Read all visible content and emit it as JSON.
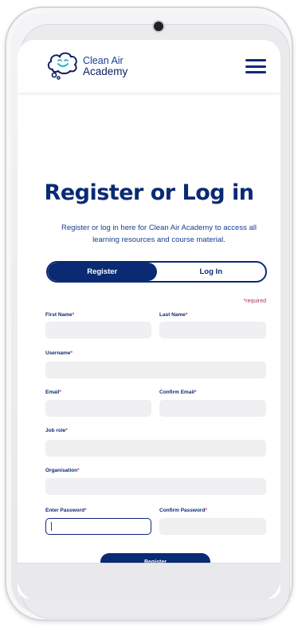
{
  "header": {
    "logo_line1": "Clean Air",
    "logo_line2": "Academy"
  },
  "page": {
    "title": "Register or Log in",
    "subtitle": "Register or log in here for Clean Air Academy to access all learning resources and course material.",
    "tabs": [
      {
        "label": "Register",
        "active": true
      },
      {
        "label": "Log In",
        "active": false
      }
    ],
    "required_note": "*required"
  },
  "form": {
    "first_name_label": "First Name",
    "last_name_label": "Last Name",
    "username_label": "Username",
    "email_label": "Email",
    "confirm_email_label": "Confirm Email",
    "job_role_label": "Job role",
    "organisation_label": "Organisation",
    "enter_password_label": "Enter Password",
    "confirm_password_label": "Confirm Password",
    "required_mark": "*",
    "submit_label": "Register"
  },
  "colors": {
    "brand_navy": "#0a2a73",
    "required_red": "#d0305a",
    "field_bg": "#f0f0f3"
  }
}
